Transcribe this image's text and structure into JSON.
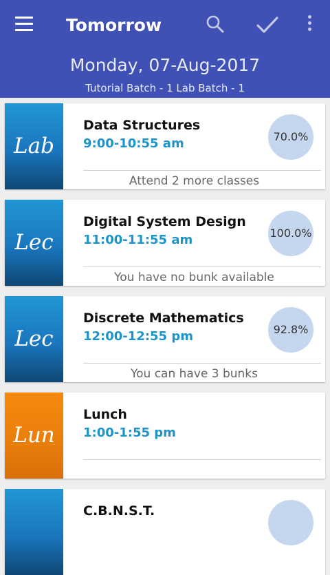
{
  "appbar": {
    "title": "Tomorrow",
    "date": "Monday, 07-Aug-2017",
    "batch": "Tutorial Batch - 1   Lab Batch - 1"
  },
  "colors": {
    "primary": "#3f51b5",
    "accent_time": "#1b95c9",
    "tag_blue": "#1a76bd",
    "tag_orange": "#f68a0f",
    "percent_circle": "#c5d6ef"
  },
  "classes": [
    {
      "tag": "Lab",
      "subject": "Data Structures",
      "time": "9:00-10:55 am",
      "percent": "70.0%",
      "note": "Attend 2 more classes"
    },
    {
      "tag": "Lec",
      "subject": "Digital System Design",
      "time": "11:00-11:55 am",
      "percent": "100.0%",
      "note": "You have no bunk available"
    },
    {
      "tag": "Lec",
      "subject": "Discrete Mathematics",
      "time": "12:00-12:55 pm",
      "percent": "92.8%",
      "note": "You can have 3 bunks"
    },
    {
      "tag": "Lun",
      "subject": "Lunch",
      "time": "1:00-1:55 pm",
      "percent": "",
      "note": ""
    },
    {
      "tag": "",
      "subject": "C.B.N.S.T.",
      "time": "",
      "percent": "",
      "note": ""
    }
  ]
}
